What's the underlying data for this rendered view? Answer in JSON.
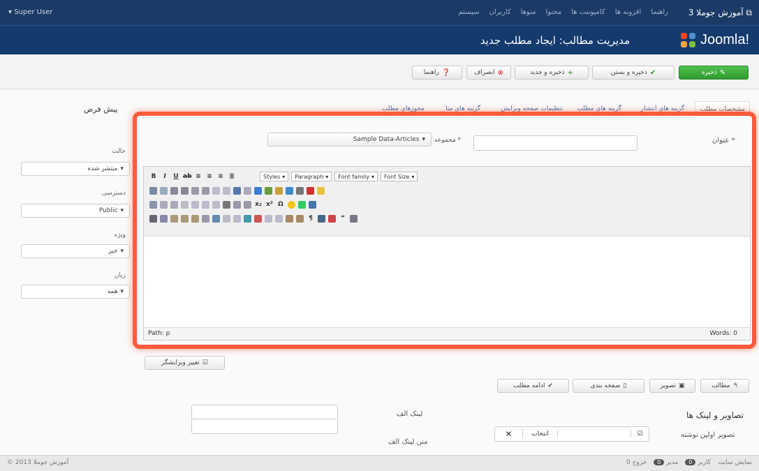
{
  "topbar": {
    "site_label": "آموزش جوملا 3",
    "menu": [
      "سیستم",
      "کاربران",
      "منوها",
      "محتوا",
      "کامپوننت ها",
      "افزونه ها",
      "راهنما"
    ],
    "user": "Super User"
  },
  "header": {
    "logo_text": "Joomla!",
    "page_title": "مدیریت مطالب: ایجاد مطلب جدید"
  },
  "toolbar": {
    "save": "ذخیره",
    "save_close": "ذخیره و بستن",
    "save_new": "ذخیره و جدید",
    "cancel": "انصراف",
    "help": "راهنما"
  },
  "tabs": [
    "مشخصات مطلب",
    "گزینه های انتشار",
    "گزینه های مطلب",
    "تنظیمات صفحه ویرایش",
    "گزینه های متا",
    "مجوزهای مطلب"
  ],
  "side": {
    "heading": "پیش فرض",
    "status_label": "حالت",
    "status_value": "منتشر شده",
    "access_label": "دسترسی",
    "access_value": "Public",
    "featured_label": "ویژه",
    "featured_value": "خیر",
    "language_label": "زبان",
    "language_value": "همه"
  },
  "form": {
    "title_label": "عنوان *",
    "category_label": "مجموعه *",
    "category_value": "Sample Data-Articles"
  },
  "editor": {
    "styles": "Styles",
    "paragraph": "Paragraph",
    "font_family": "Font family",
    "font_size": "Font Size",
    "path": "Path: p",
    "words": "Words: 0"
  },
  "below": {
    "article_btn": "مطالب",
    "image_btn": "تصویر",
    "pagebreak_btn": "صفحه بندی",
    "readmore_btn": "ادامه مطلب",
    "toggle_editor": "تغییر ویرایشگر",
    "section_title": "تصاویر و لینک ها",
    "link_a_label": "لینک الف",
    "link_a_text_label": "متن لینک الف",
    "intro_image_label": "تصویر اولین نوشته",
    "select_label": "انتخاب"
  },
  "footer": {
    "copyright": "© آموزش جوملا 2013",
    "view_site": "نمایش سایت",
    "visitors": "کاربر",
    "admin": "مدیر",
    "messages": "0 خروج"
  },
  "colors": {
    "topbar": "#1b3a66",
    "titlebar": "#143a6e",
    "highlight": "#ff5a3d",
    "save_green": "#3aaa3a"
  }
}
